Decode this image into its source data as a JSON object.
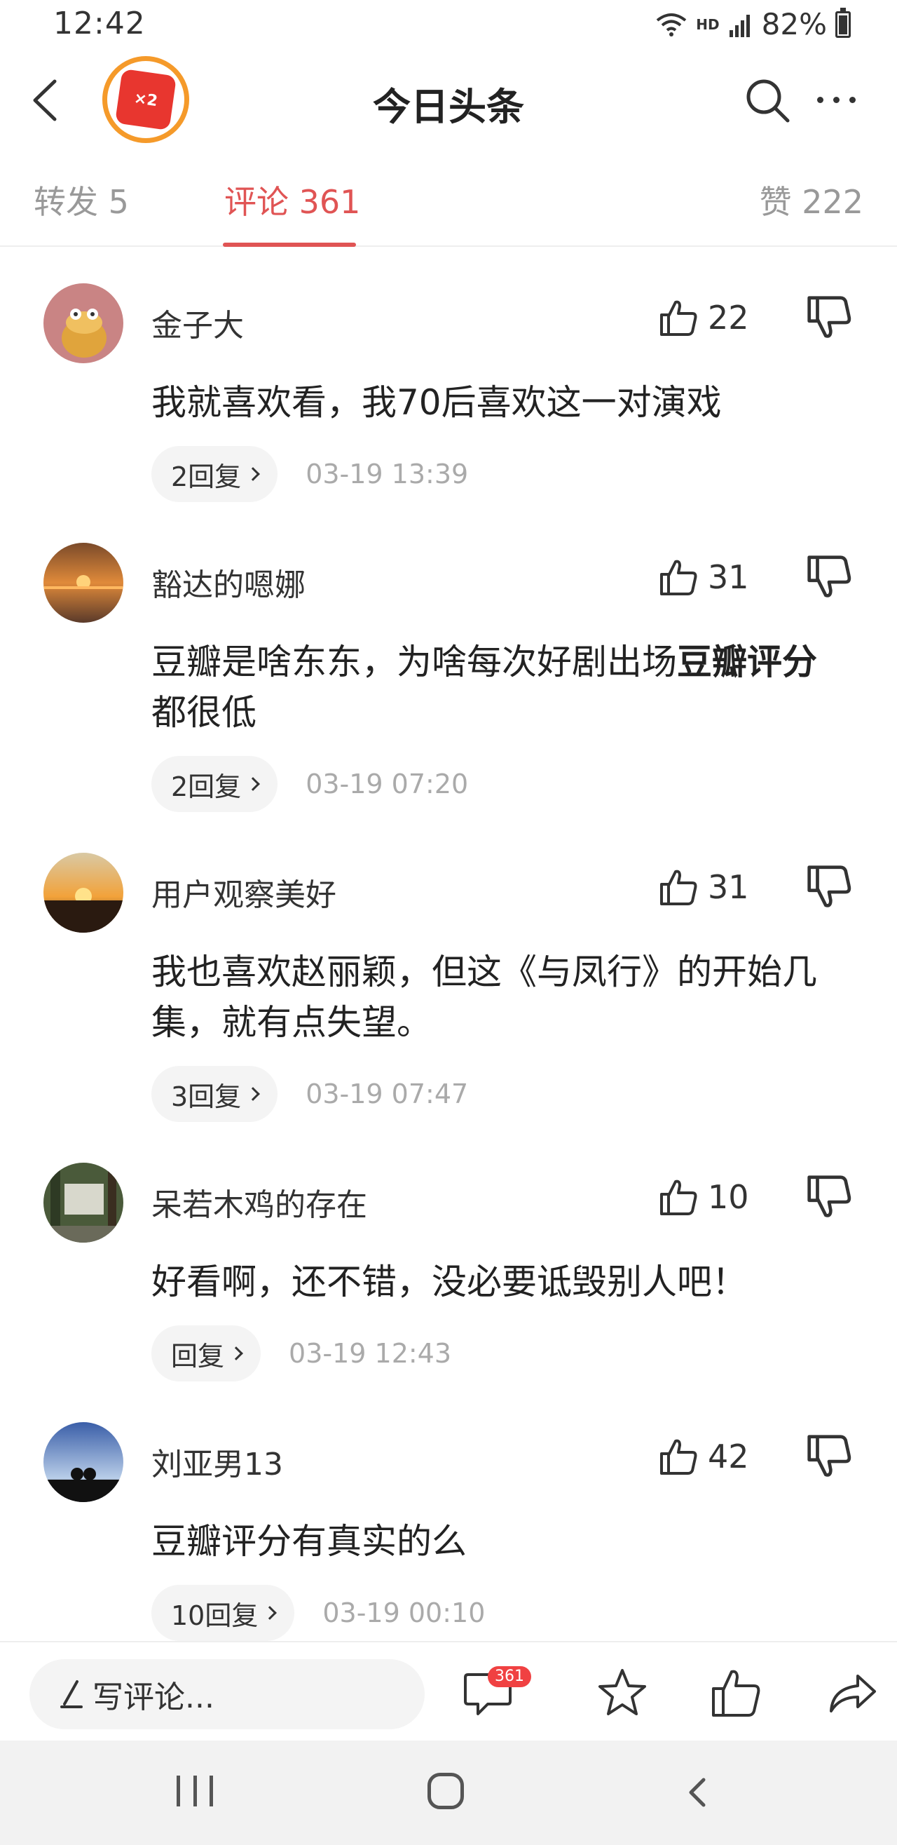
{
  "status_bar": {
    "time": "12:42",
    "network": "HD",
    "battery": "82%",
    "battery_level": 0.82
  },
  "header": {
    "title": "今日头条",
    "badge_text": "×2"
  },
  "tabs": [
    {
      "label": "转发 5"
    },
    {
      "label": "评论 361",
      "active": true
    },
    {
      "label": "赞 222"
    }
  ],
  "comments": [
    {
      "user": "金子大",
      "likes": "22",
      "text": "我就喜欢看，我70后喜欢这一对演戏",
      "replies": "2回复",
      "time": "03-19 13:39"
    },
    {
      "user": "豁达的嗯娜",
      "likes": "31",
      "text_before": "豆瓣是啥东东，为啥每次好剧出场",
      "text_bold": "豆瓣评分",
      "text_after": "都很低",
      "replies": "2回复",
      "time": "03-19 07:20"
    },
    {
      "user": "用户观察美好",
      "likes": "31",
      "text": "我也喜欢赵丽颖，但这《与凤行》的开始几集，就有点失望。",
      "replies": "3回复",
      "time": "03-19 07:47"
    },
    {
      "user": "呆若木鸡的存在",
      "likes": "10",
      "text": "好看啊，还不错，没必要诋毁别人吧！",
      "replies": "回复",
      "time": "03-19 12:43"
    },
    {
      "user": "刘亚男13",
      "likes": "42",
      "text": "豆瓣评分有真实的么",
      "replies": "10回复",
      "time": "03-19 00:10"
    }
  ],
  "bottom_bar": {
    "write_placeholder": "写评论...",
    "comment_count": "361"
  },
  "colors": {
    "accent": "#e05454",
    "badge_red": "#f04142",
    "badge_ring": "#f59a2a"
  }
}
